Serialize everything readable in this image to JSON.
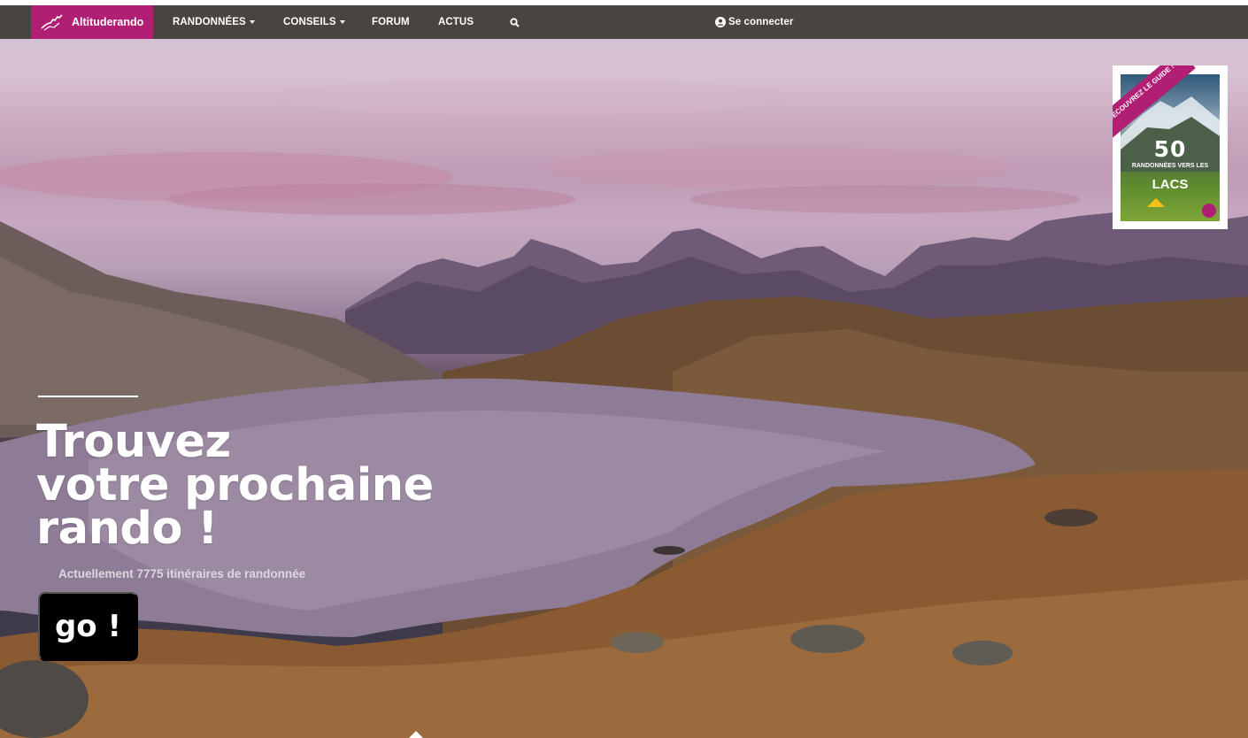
{
  "nav": {
    "brand": "Altituderando",
    "items": [
      {
        "label": "RANDONNÉES",
        "dropdown": true
      },
      {
        "label": "CONSEILS",
        "dropdown": true
      },
      {
        "label": "FORUM",
        "dropdown": false
      },
      {
        "label": "ACTUS",
        "dropdown": false
      }
    ],
    "login_label": "Se connecter"
  },
  "promo": {
    "ribbon": "DÉCOUVREZ LE GUIDE !",
    "number": "50",
    "subtitle": "RANDONNÉES VERS LES",
    "title": "LACS"
  },
  "hero": {
    "headline_lines": [
      "Trouvez",
      "votre prochaine",
      "rando !"
    ],
    "subline": "Actuellement 7775 itinéraires de randonnée",
    "go_label": "go !"
  },
  "colors": {
    "brand": "#b01f73",
    "navbar": "#48443f",
    "button": "#000000"
  },
  "icons": [
    "brand-logo-icon",
    "caret-down-icon",
    "search-icon",
    "user-icon",
    "scroll-up-arrow-icon"
  ]
}
